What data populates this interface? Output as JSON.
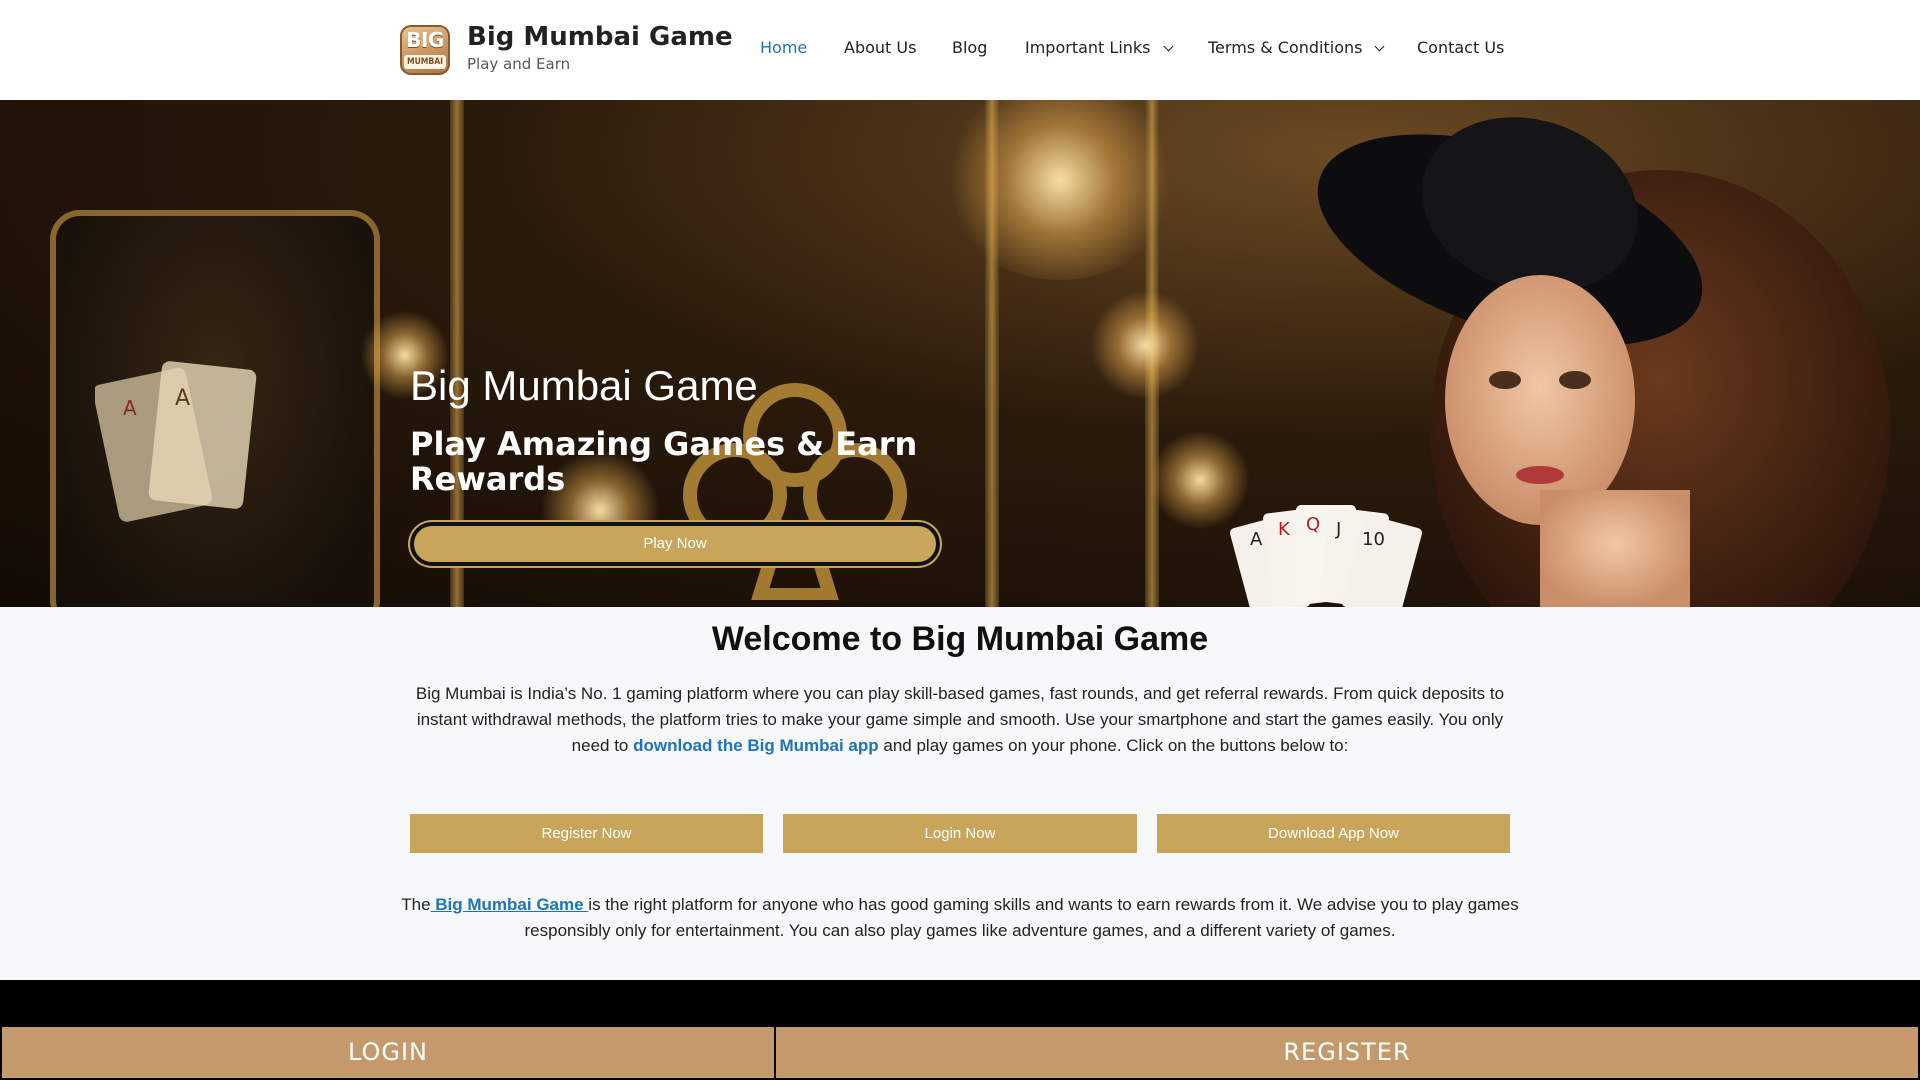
{
  "header": {
    "logo_text_top": "BIG",
    "logo_text_bottom": "MUMBAI",
    "site_title": "Big Mumbai Game",
    "tagline": "Play and Earn",
    "nav": [
      {
        "label": "Home",
        "active": true,
        "dropdown": false
      },
      {
        "label": "About Us",
        "active": false,
        "dropdown": false
      },
      {
        "label": "Blog",
        "active": false,
        "dropdown": false
      },
      {
        "label": "Important Links",
        "active": false,
        "dropdown": true
      },
      {
        "label": "Terms & Conditions",
        "active": false,
        "dropdown": true
      },
      {
        "label": "Contact Us",
        "active": false,
        "dropdown": false
      }
    ]
  },
  "hero": {
    "title": "Big Mumbai Game",
    "subtitle": "Play Amazing Games & Earn Rewards",
    "play_button": "Play Now"
  },
  "welcome": {
    "title": "Welcome to Big Mumbai Game",
    "text_before_link": "Big Mumbai is India’s No. 1 gaming platform where you can play skill-based games, fast rounds, and get referral rewards. From quick deposits to instant withdrawal methods, the platform tries to make your game simple and smooth. Use your smartphone and start the games easily. You only need to ",
    "link_text": "download the Big Mumbai app",
    "text_after_link": " and play games on your phone. Click on the buttons below to:"
  },
  "cta_buttons": {
    "register": "Register Now",
    "login": "Login Now",
    "download": "Download App Now"
  },
  "body": {
    "prefix": "The",
    "link_text": " Big Mumbai Game ",
    "suffix": "is the right platform for anyone who has good gaming skills and wants to earn rewards from it. We advise you to play games responsibly only for entertainment. You can also play games like adventure games, and a different variety of games."
  },
  "bottom_bar": {
    "login": "LOGIN",
    "register": "REGISTER"
  },
  "colors": {
    "accent_gold": "#c8a55b",
    "link_blue": "#1e73be",
    "bottom_bar": "#c49a6c"
  },
  "icons": [
    "logo-icon",
    "chevron-down-icon"
  ]
}
